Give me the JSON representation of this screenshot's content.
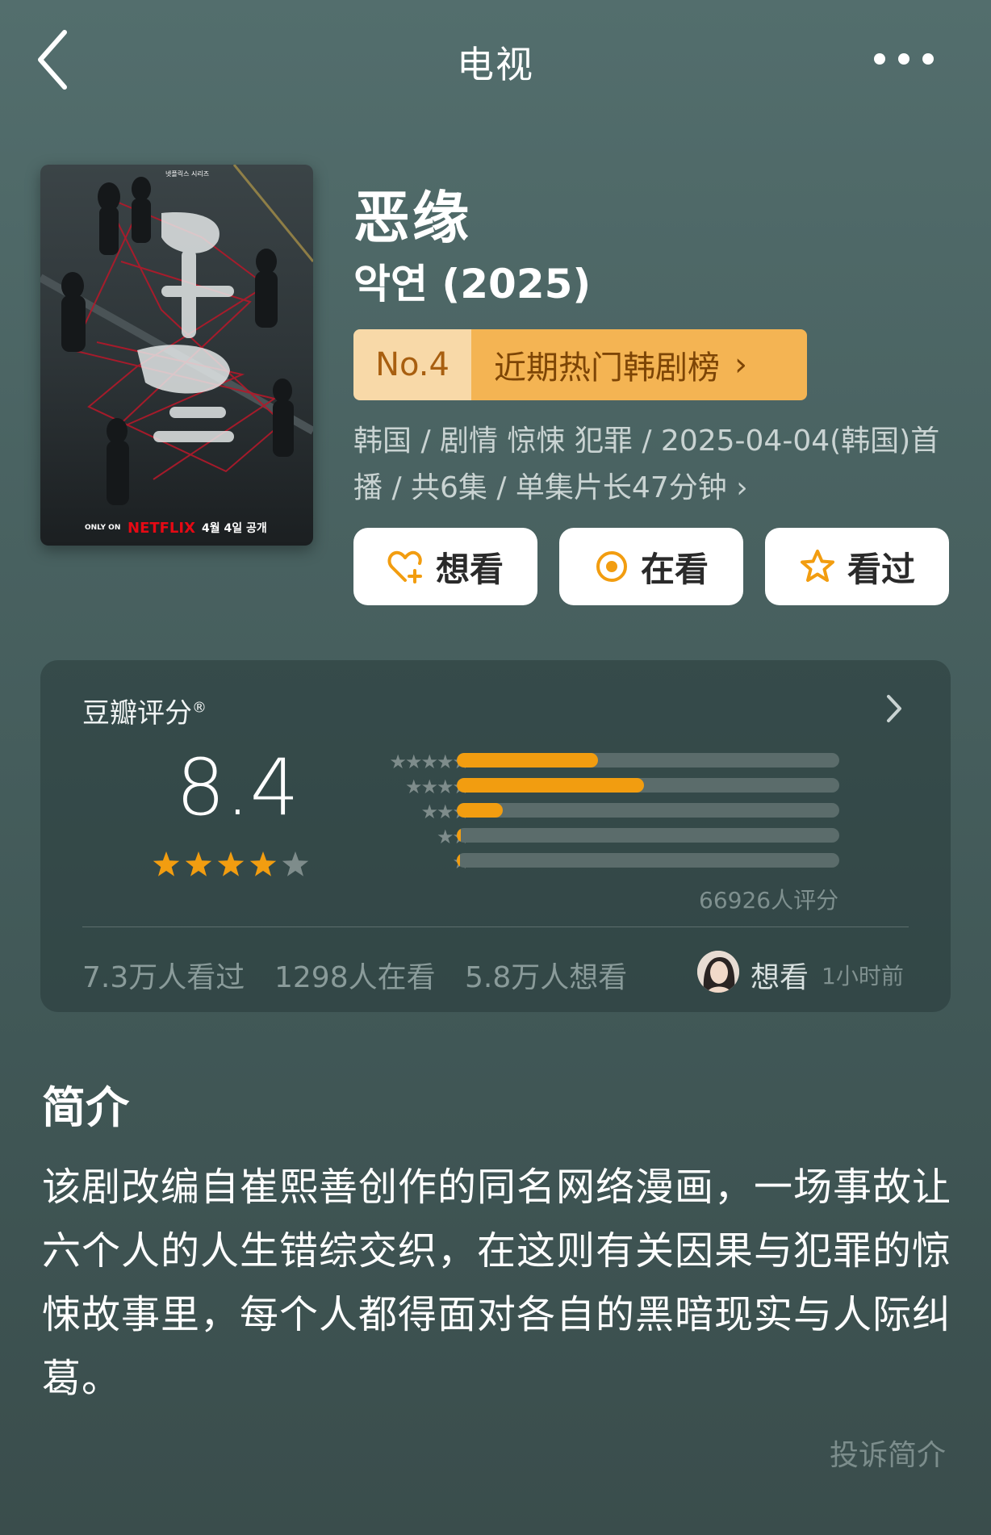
{
  "header": {
    "title": "电视",
    "back_icon": "chevron-left-icon",
    "more_icon": "more-dots-icon"
  },
  "movie": {
    "title_cn": "恶缘",
    "title_original": "악연 (2025)",
    "rank": {
      "number": "No.4",
      "list_name": "近期热门韩剧榜",
      "chevron": "›"
    },
    "meta": "韩国 / 剧情 惊悚 犯罪 / 2025-04-04(韩国)首播 / 共6集 / 单集片长47分钟 ›",
    "poster_text": {
      "korean_title": "악연",
      "top_label": "넷플릭스 시리즈",
      "bottom_left": "ONLY ON",
      "brand": "NETFLIX",
      "date": "4월 4일 공개"
    }
  },
  "actions": {
    "want": "想看",
    "watching": "在看",
    "watched": "看过"
  },
  "rating": {
    "label": "豆瓣评分",
    "registered_mark": "®",
    "score": "8.4",
    "stars_filled": 4,
    "stars_total": 5,
    "distribution": [
      {
        "stars": 5,
        "fraction": 0.37
      },
      {
        "stars": 4,
        "fraction": 0.49
      },
      {
        "stars": 3,
        "fraction": 0.12
      },
      {
        "stars": 2,
        "fraction": 0.01
      },
      {
        "stars": 1,
        "fraction": 0.005
      }
    ],
    "count_text": "66926人评分",
    "watched_text": "7.3万人看过",
    "watching_text": "1298人在看",
    "want_text": "5.8万人想看",
    "friend_action": "想看",
    "friend_time": "1小时前"
  },
  "intro": {
    "heading": "简介",
    "text": "该剧改编自崔熙善创作的同名网络漫画，一场事故让六个人的人生错综交织，在这则有关因果与犯罪的惊悚故事里，每个人都得面对各自的黑暗现实与人际纠葛。",
    "complain_link": "投诉简介"
  },
  "colors": {
    "accent_orange": "#f29d10",
    "rank_badge_light": "#f8d9a8",
    "rank_badge_dark": "#f4b453",
    "background": "#4a6362"
  }
}
